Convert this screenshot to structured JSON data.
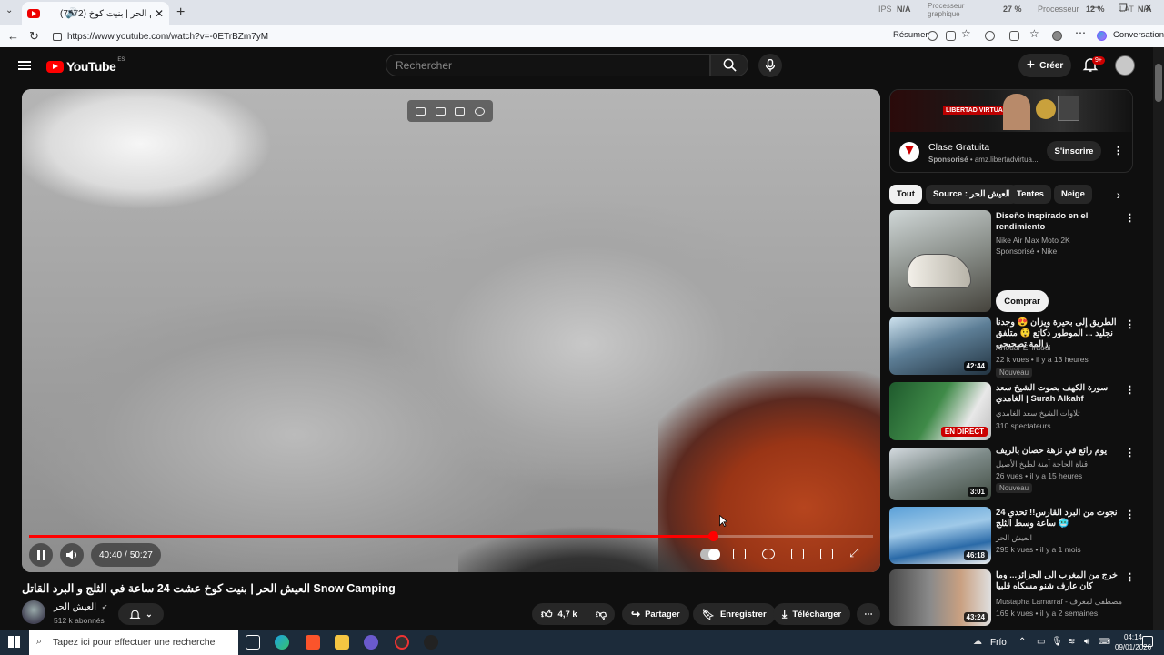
{
  "browser": {
    "tab_title": "(7672) العيش الحر | بنيت كوخ ...",
    "url": "https://www.youtube.com/watch?v=-0ETrBZm7yM",
    "resumer": "Résumer",
    "conversation": "Conversation",
    "sys_ips": "IPS",
    "sys_na1": "N/A",
    "sys_proc_label": "Processeur graphique",
    "sys_gpu": "27 %",
    "sys_proc2": "Processeur",
    "sys_cpu": "12 %",
    "sys_lat": "LAT",
    "sys_na2": "N/A"
  },
  "header": {
    "logo_text": "YouTube",
    "logo_country": "ES",
    "search_placeholder": "Rechercher",
    "create_label": "Créer",
    "notif_count": "9+"
  },
  "player": {
    "current_time": "40:40",
    "duration": "50:27",
    "progress": 0.81
  },
  "video": {
    "title": "العيش الحر | بنيت كوخ عشت 24 ساعة في الثلج و البرد القاتل Snow Camping",
    "channel": "العيش الحر",
    "subscribers": "512 k abonnés",
    "likes": "4,7 k",
    "share": "Partager",
    "save": "Enregistrer",
    "download": "Télécharger"
  },
  "ad": {
    "brand_badge": "LIBERTAD VIRTUAL",
    "title": "Clase Gratuita",
    "sponsored": "Sponsorisé",
    "domain": "amz.libertadvirtua...",
    "button": "S'inscrire"
  },
  "chips": [
    "Tout",
    "Source : العيش الحر",
    "Tentes",
    "Neige"
  ],
  "sponsored_item": {
    "title": "Diseño inspirado en el rendimiento",
    "sub": "Nike Air Max Moto 2K",
    "meta": "Sponsorisé • Nike",
    "button": "Comprar"
  },
  "related": [
    {
      "title": "الطريق إلى بحيرة ويزان 😍 وجدنا نجليد ... الموطور دكاتع 😲 متلفق زالمة تصحبحي",
      "channel": "Anouar El iraoui",
      "meta": "22 k vues • il y a 13 heures",
      "badge": "Nouveau",
      "duration": "42:44"
    },
    {
      "title": "سورة الكهف بصوت الشيخ سعد الغامدي | Surah Alkahf",
      "channel": "تلاوات الشيخ سعد الغامدي",
      "meta": "310 spectateurs",
      "badge": "",
      "duration": "EN DIRECT"
    },
    {
      "title": "يوم رائع في نزهة حصان بالريف",
      "channel": "قناة الحاجة آمنة لطبخ الأصيل",
      "meta": "26 vues • il y a 15 heures",
      "badge": "Nouveau",
      "duration": "3:01"
    },
    {
      "title": "نجوت من البرد القارس!! تحدي 24 ساعة وسط الثلج 🥶",
      "channel": "العيش الحر",
      "meta": "295 k vues • il y a 1 mois",
      "badge": "",
      "duration": "46:18"
    },
    {
      "title": "خرج من المغرب الى الجزائر... وما كان عارف شنو مسكاه قلبيا",
      "channel": "Mustapha Lamarraf - مصطفى لمعرف",
      "meta": "169 k vues • il y a 2 semaines",
      "badge": "",
      "duration": "43:24"
    }
  ],
  "taskbar": {
    "search": "Tapez ici pour effectuer une recherche",
    "weather": "Frío",
    "time": "04:14",
    "date": "09/01/2026"
  },
  "colors": {
    "accent": "#ff0000",
    "bg": "#0f0f0f",
    "chip": "#272727"
  }
}
